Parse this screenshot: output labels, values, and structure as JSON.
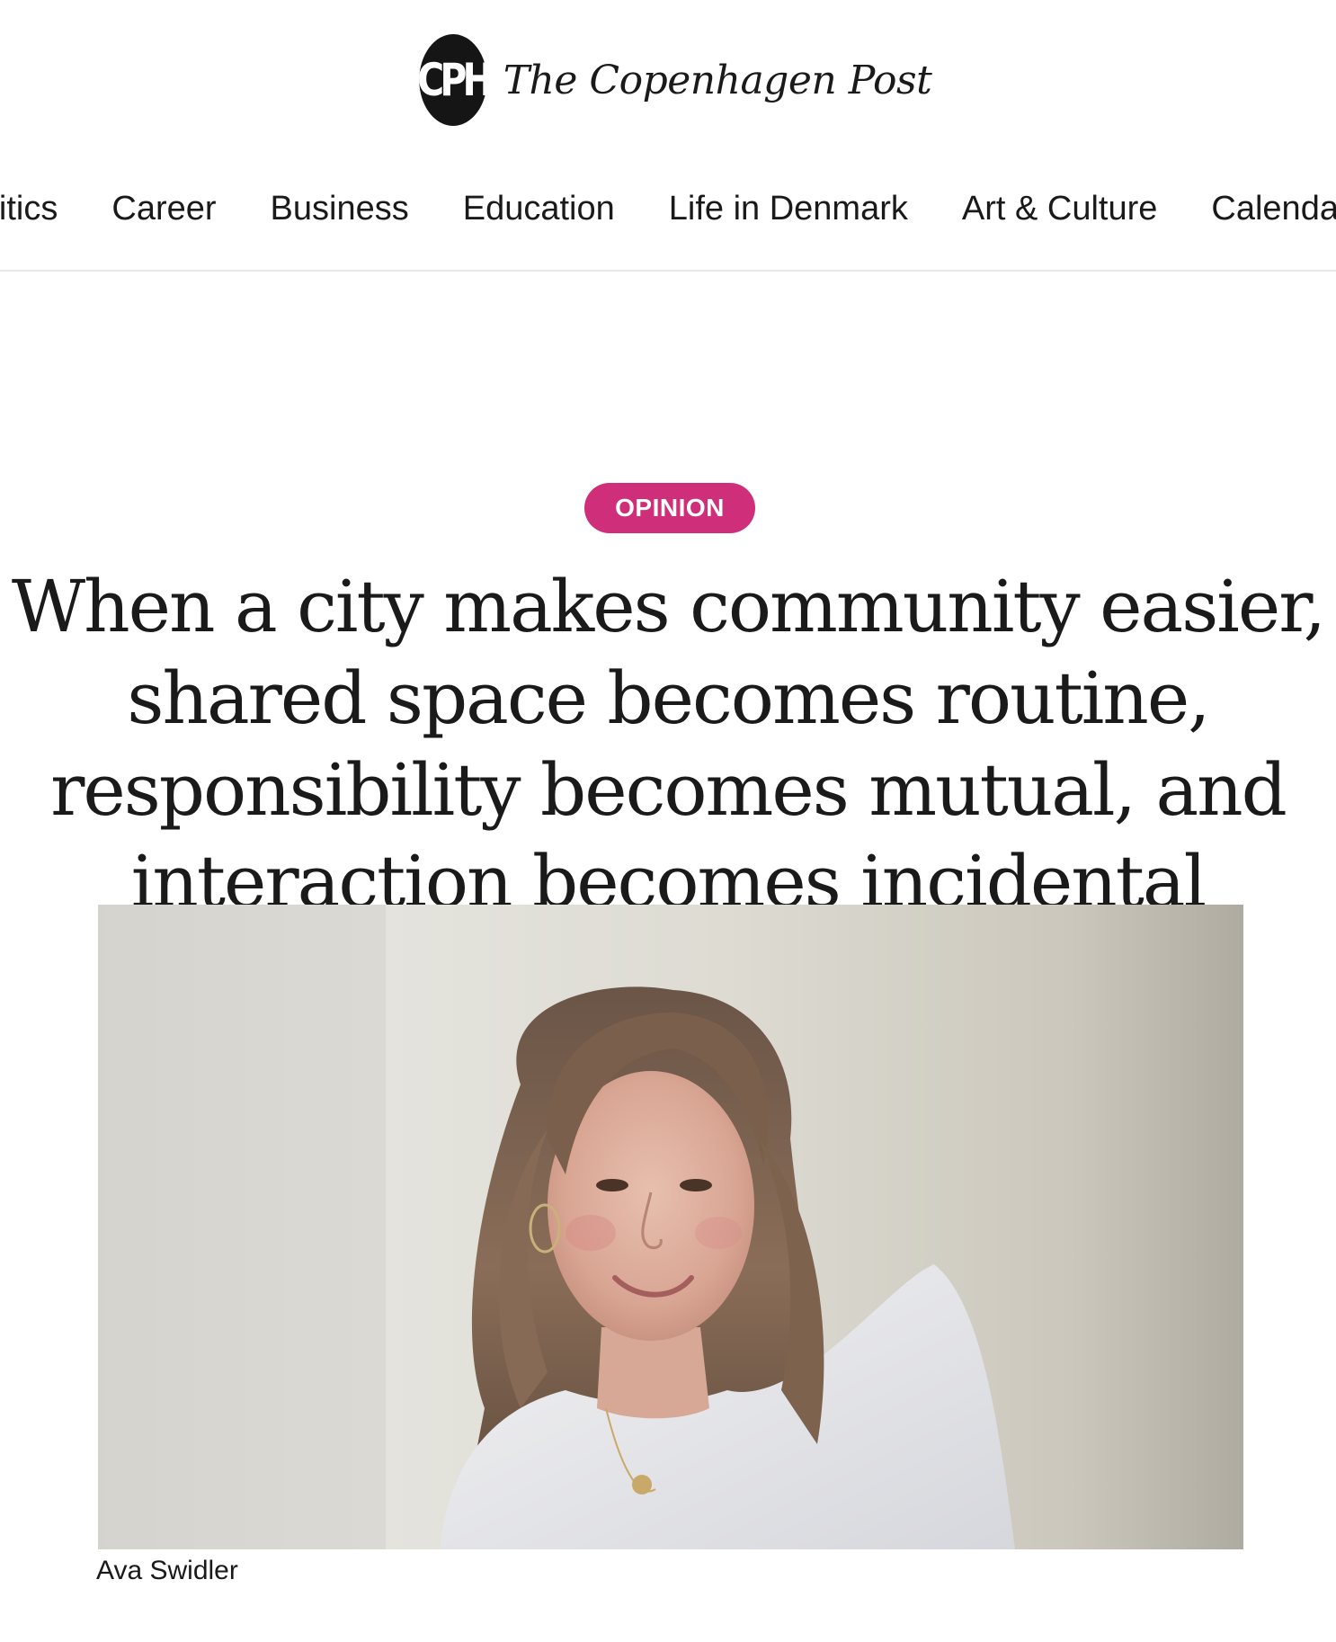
{
  "masthead": {
    "logo_mark": "CPH",
    "site_name": "The Copenhagen Post"
  },
  "nav": {
    "items": [
      {
        "label": "Politics"
      },
      {
        "label": "Career"
      },
      {
        "label": "Business"
      },
      {
        "label": "Education"
      },
      {
        "label": "Life in Denmark"
      },
      {
        "label": "Art & Culture"
      },
      {
        "label": "Calendar"
      }
    ]
  },
  "article": {
    "category": "OPINION",
    "category_color": "#cf2f7a",
    "headline": "When a city makes community easier, shared space becomes routine, responsibility becomes mutual, and interaction becomes incidental",
    "image": {
      "caption": "Ava Swidler"
    }
  }
}
